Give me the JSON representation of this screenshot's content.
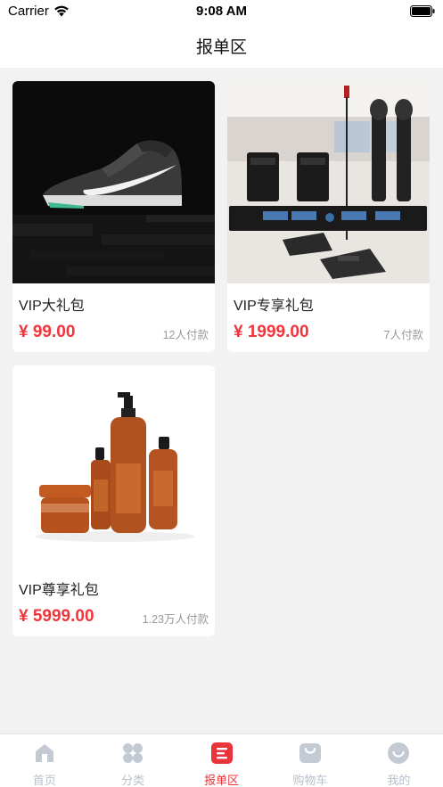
{
  "status_bar": {
    "carrier": "Carrier",
    "time": "9:08 AM"
  },
  "nav": {
    "title": "报单区"
  },
  "products": [
    {
      "name": "VIP大礼包",
      "price": "¥ 99.00",
      "sales": "12人付款",
      "image": "sneaker-photo"
    },
    {
      "name": "VIP专享礼包",
      "price": "¥ 1999.00",
      "sales": "7人付款",
      "image": "wireless-microphone-set-photo"
    },
    {
      "name": "VIP尊享礼包",
      "price": "¥ 5999.00",
      "sales": "1.23万人付款",
      "image": "haircare-products-photo"
    }
  ],
  "tabs": [
    {
      "label": "首页",
      "icon": "home-icon",
      "active": false
    },
    {
      "label": "分类",
      "icon": "category-icon",
      "active": false
    },
    {
      "label": "报单区",
      "icon": "order-list-icon",
      "active": true
    },
    {
      "label": "购物车",
      "icon": "cart-icon",
      "active": false
    },
    {
      "label": "我的",
      "icon": "profile-icon",
      "active": false
    }
  ],
  "colors": {
    "accent": "#e8343a",
    "price": "#f0353b",
    "tab_inactive": "#b8c0cc",
    "background": "#f2f2f2"
  }
}
